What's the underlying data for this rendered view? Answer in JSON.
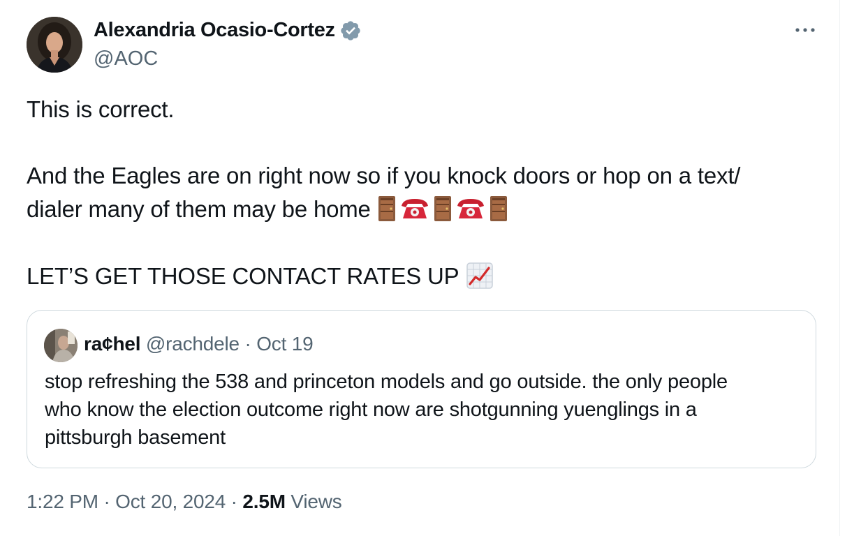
{
  "author": {
    "name": "Alexandria Ocasio-Cortez",
    "handle": "@AOC",
    "verified": true
  },
  "tweet": {
    "lines": [
      "This is correct.",
      "And the Eagles are on right now so if you knock doors or hop on a text/",
      "dialer many of them may be home",
      "LET’S GET THOSE CONTACT RATES UP"
    ],
    "emojis_line3": [
      "door-icon",
      "telephone-icon",
      "door-icon",
      "telephone-icon",
      "door-icon"
    ],
    "emoji_line4": "chart-increasing-icon"
  },
  "quote": {
    "name": "ra¢hel",
    "meta": "@rachdele · Oct 19",
    "lines": [
      "stop refreshing the 538 and princeton models and go outside. the only people",
      "who know the election outcome right now are shotgunning yuenglings in a",
      "pittsburgh basement"
    ]
  },
  "footer": {
    "time": "1:22 PM · Oct 20, 2024 · ",
    "views_count": "2.5M",
    "views_label": " Views"
  },
  "colors": {
    "text": "#0f1419",
    "secondary": "#536471",
    "border": "#cfd9de",
    "verified": "#829aab"
  }
}
